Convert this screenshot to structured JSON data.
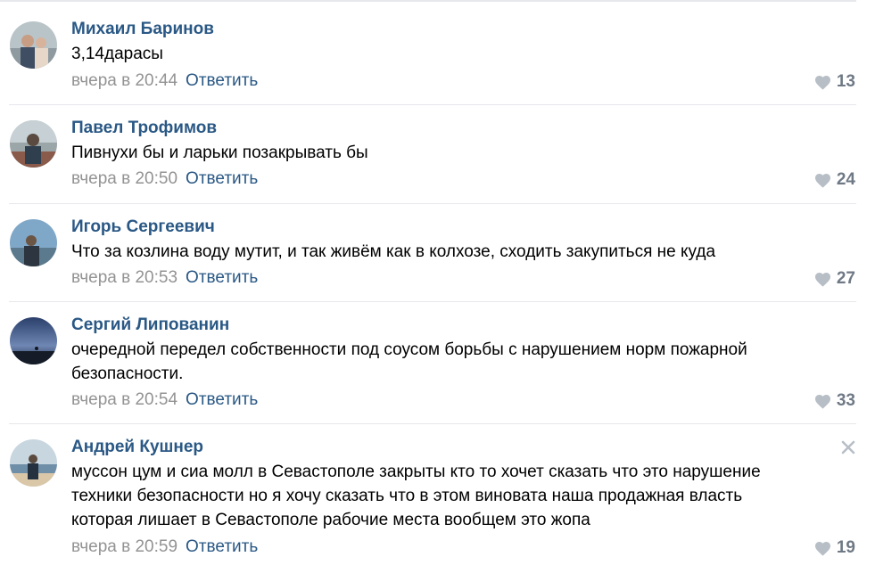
{
  "colors": {
    "author": "#2a5885",
    "time": "#939393",
    "reply": "#2a5885",
    "like_icon": "#b7bec6",
    "like_count": "#6f7985",
    "divider": "#e7e8ec"
  },
  "comments": [
    {
      "author": "Михаил Баринов",
      "text": [
        "3,14дарасы"
      ],
      "time": "вчера в 20:44",
      "reply": "Ответить",
      "likes": "13",
      "avatar_icon": "avatar-couple-photo"
    },
    {
      "author": "Павел Трофимов",
      "text": [
        "Пивнухи бы и ларьки позакрывать бы"
      ],
      "time": "вчера в 20:50",
      "reply": "Ответить",
      "likes": "24",
      "avatar_icon": "avatar-man-photo"
    },
    {
      "author": "Игорь Сергеевич",
      "text": [
        "Что за козлина воду мутит, и так живём как в колхозе, сходить закупиться не куда"
      ],
      "time": "вчера в 20:53",
      "reply": "Ответить",
      "likes": "27",
      "avatar_icon": "avatar-seaside-photo"
    },
    {
      "author": "Сергий Липованин",
      "text": [
        "очередной передел собственности под соусом борьбы с нарушением норм пожарной",
        "безопасности."
      ],
      "time": "вчера в 20:54",
      "reply": "Ответить",
      "likes": "33",
      "avatar_icon": "avatar-sunset-photo"
    },
    {
      "author": "Андрей Кушнер",
      "text": [
        "муссон цум и сиа молл в Севастополе закрыты кто то хочет сказать что это нарушение",
        "техники безопасности но я хочу сказать что в этом виновата наша продажная власть",
        "которая лишает в Севастополе рабочие места вообщем это жопа"
      ],
      "time": "вчера в 20:59",
      "reply": "Ответить",
      "likes": "19",
      "avatar_icon": "avatar-beach-photo",
      "close_icon": "close-icon"
    }
  ]
}
